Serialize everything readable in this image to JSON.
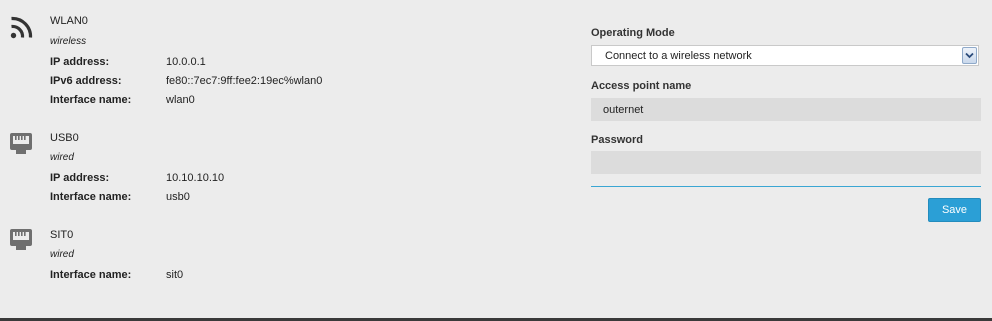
{
  "interfaces": [
    {
      "name": "WLAN0",
      "type": "wireless",
      "icon": "wifi-icon",
      "rows": [
        {
          "label": "IP address:",
          "value": "10.0.0.1"
        },
        {
          "label": "IPv6 address:",
          "value": "fe80::7ec7:9ff:fee2:19ec%wlan0"
        },
        {
          "label": "Interface name:",
          "value": "wlan0"
        }
      ]
    },
    {
      "name": "USB0",
      "type": "wired",
      "icon": "ethernet-port-icon",
      "rows": [
        {
          "label": "IP address:",
          "value": "10.10.10.10"
        },
        {
          "label": "Interface name:",
          "value": "usb0"
        }
      ]
    },
    {
      "name": "SIT0",
      "type": "wired",
      "icon": "ethernet-port-icon",
      "rows": [
        {
          "label": "Interface name:",
          "value": "sit0"
        }
      ]
    }
  ],
  "form": {
    "operating_mode_label": "Operating Mode",
    "operating_mode_value": "Connect to a wireless network",
    "ap_name_label": "Access point name",
    "ap_name_value": "outernet",
    "password_label": "Password",
    "password_value": "",
    "save_label": "Save"
  },
  "colors": {
    "accent": "#2b9fd6",
    "background": "#ececec",
    "field_background": "#dcdcdc"
  }
}
